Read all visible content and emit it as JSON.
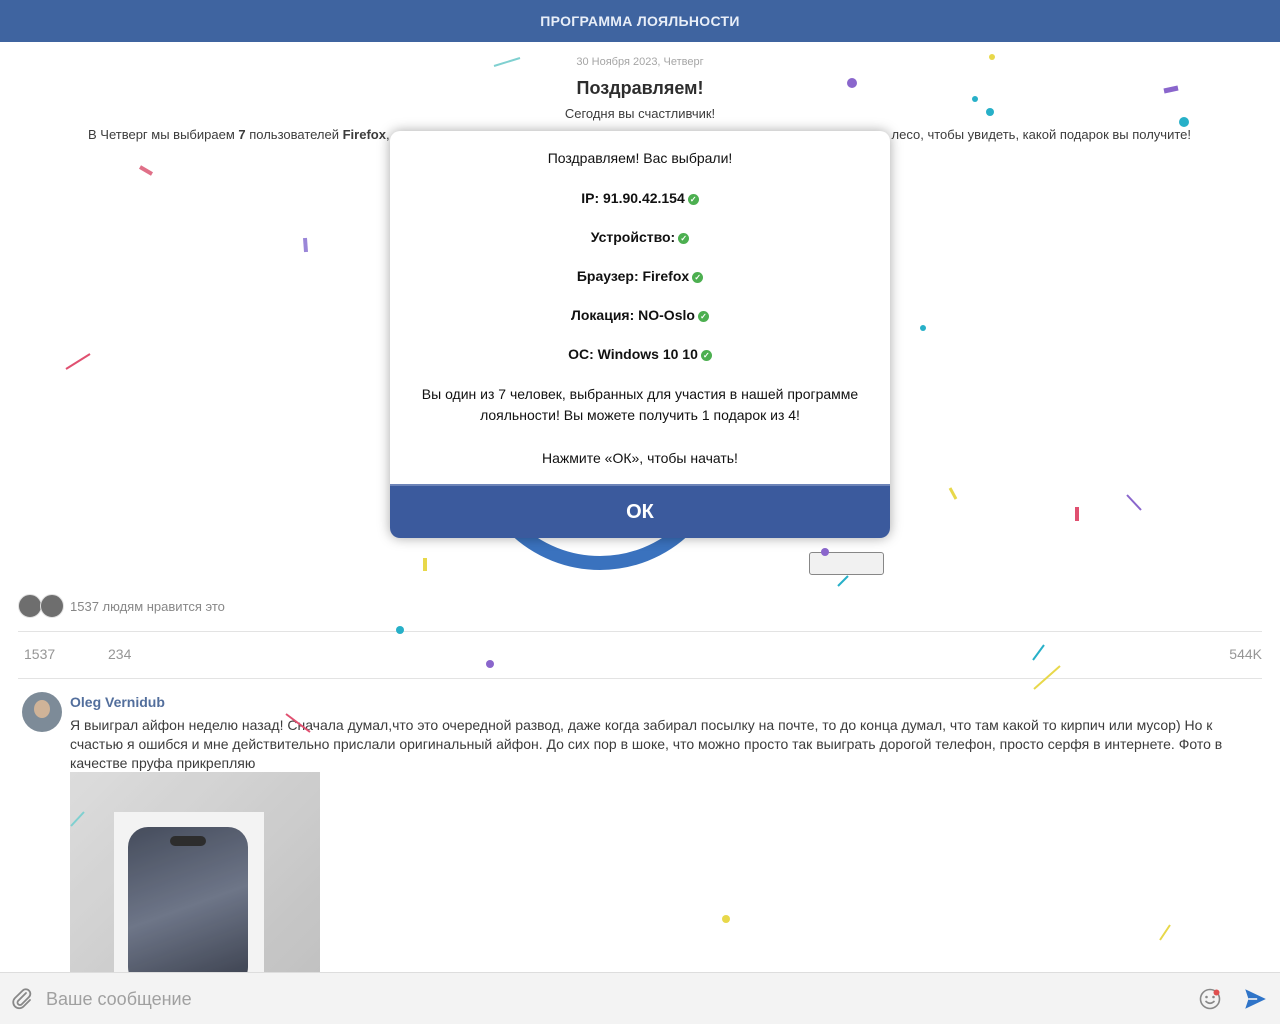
{
  "header": {
    "title": "ПРОГРАММА ЛОЯЛЬНОСТИ"
  },
  "post": {
    "date": "30 Ноября 2023, Четверг",
    "congrats": "Поздравляем!",
    "lucky": "Сегодня вы счастливчик!",
    "intro_prefix": "В Четверг мы выбираем ",
    "intro_count": "7",
    "intro_mid": " пользователей ",
    "intro_browser": "Firefox",
    "intro_tail": ",",
    "intro_right": "лесо, чтобы увидеть, какой подарок вы получите!"
  },
  "likes": {
    "text": "1537 людям нравится это",
    "count": "1537",
    "comments": "234",
    "shares": "544K"
  },
  "comment": {
    "author": "Oleg Vernidub",
    "text": "Я выиграл айфон неделю назад! Сначала думал,что это очередной развод, даже когда забирал посылку на почте, то до конца думал, что там какой то кирпич или мусор) Но к счастью я ошибся и мне действительно прислали оригинальный айфон. До сих пор в шоке, что можно просто так выиграть дорогой телефон, просто серфя в интернете. Фото в качестве пруфа прикрепляю"
  },
  "modal": {
    "title": "Поздравляем! Вас выбрали!",
    "ip": "IP: 91.90.42.154",
    "device": "Устройство:",
    "browser": "Браузер: Firefox",
    "location": "Локация: NO-Oslo",
    "os": "ОС: Windows 10 10",
    "message": "Вы один из 7 человек, выбранных для участия в нашей программе лояльности! Вы можете получить 1 подарок из 4!",
    "instruction": "Нажмите «ОК», чтобы начать!",
    "ok_label": "ОК"
  },
  "composer": {
    "placeholder": "Ваше сообщение"
  },
  "colors": {
    "header": "#3f64a0",
    "ok_button": "#3b5a9d",
    "check": "#4caf50",
    "author": "#3b5b8f"
  },
  "icons": [
    "paperclip-icon",
    "emoji-icon",
    "send-icon",
    "check-icon"
  ]
}
